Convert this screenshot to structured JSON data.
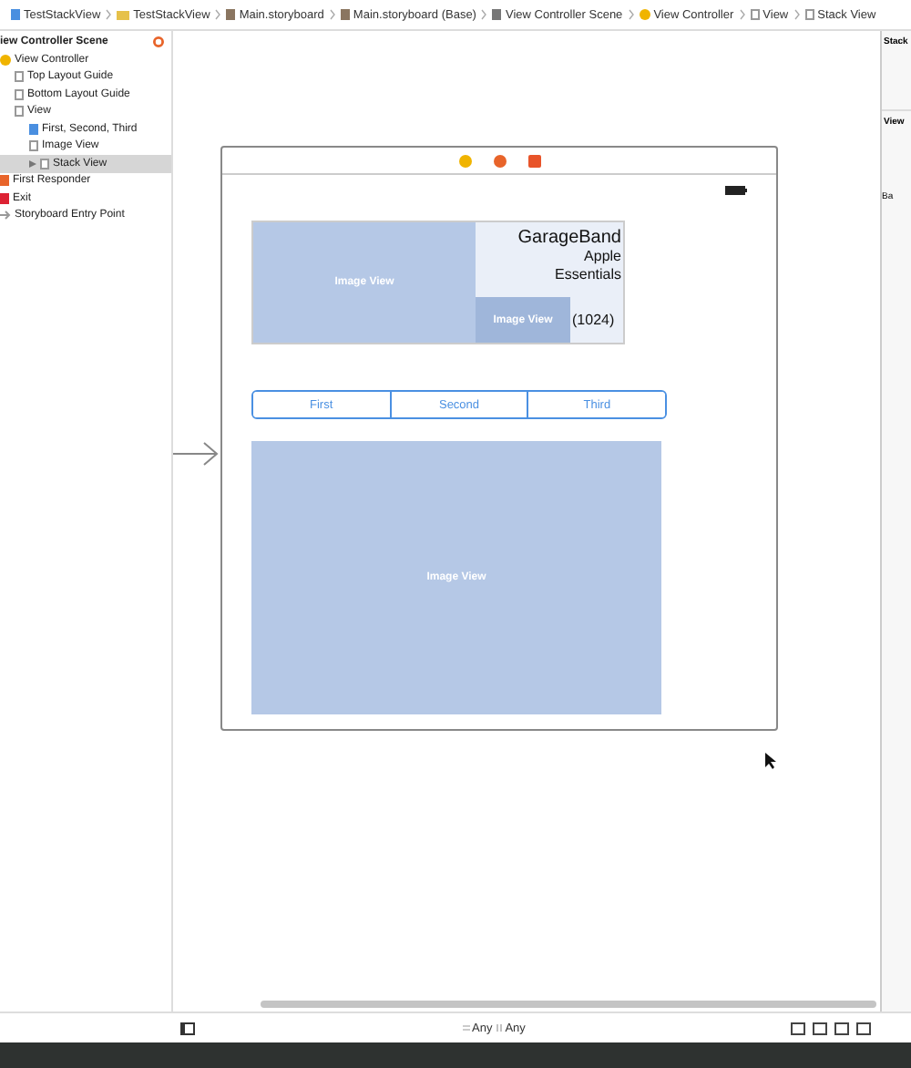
{
  "breadcrumbs": [
    {
      "label": "TestStackView",
      "kind": "file"
    },
    {
      "label": "TestStackView",
      "kind": "folder"
    },
    {
      "label": "Main.storyboard",
      "kind": "doc"
    },
    {
      "label": "Main.storyboard (Base)",
      "kind": "doc"
    },
    {
      "label": "View Controller Scene",
      "kind": "scene"
    },
    {
      "label": "View Controller",
      "kind": "controller"
    },
    {
      "label": "View",
      "kind": "view"
    },
    {
      "label": "Stack View",
      "kind": "stack"
    }
  ],
  "outline": {
    "title": "iew Controller Scene",
    "items": [
      {
        "label": "View Controller",
        "kind": "controller",
        "selected": false,
        "children": [
          {
            "label": "Top Layout Guide",
            "kind": "view",
            "selected": false
          },
          {
            "label": "Bottom Layout Guide",
            "kind": "view",
            "selected": false
          },
          {
            "label": "View",
            "kind": "view",
            "selected": false,
            "children": [
              {
                "label": "First, Second, Third",
                "kind": "segment",
                "selected": false
              },
              {
                "label": "Image View",
                "kind": "view",
                "selected": false
              },
              {
                "label": "Stack View",
                "kind": "stack",
                "selected": true,
                "expanded": false
              }
            ]
          }
        ]
      },
      {
        "label": "First Responder",
        "kind": "responder",
        "selected": false
      },
      {
        "label": "Exit",
        "kind": "exit",
        "selected": false
      },
      {
        "label": "Storyboard Entry Point",
        "kind": "arrow",
        "selected": false
      }
    ]
  },
  "scene": {
    "stack": {
      "image_label": "Image View",
      "title": "GarageBand",
      "subtitle": "Apple Essentials",
      "small_image_label": "Image View",
      "count": "(1024)"
    },
    "segments": [
      {
        "label": "First",
        "selected": false
      },
      {
        "label": "Second",
        "selected": false
      },
      {
        "label": "Third",
        "selected": false
      }
    ],
    "large_image_label": "Image View"
  },
  "size_class": {
    "width": "Any",
    "height": "Any"
  },
  "inspector": {
    "sections": [
      "Stack",
      "View"
    ],
    "label": "Ba"
  }
}
